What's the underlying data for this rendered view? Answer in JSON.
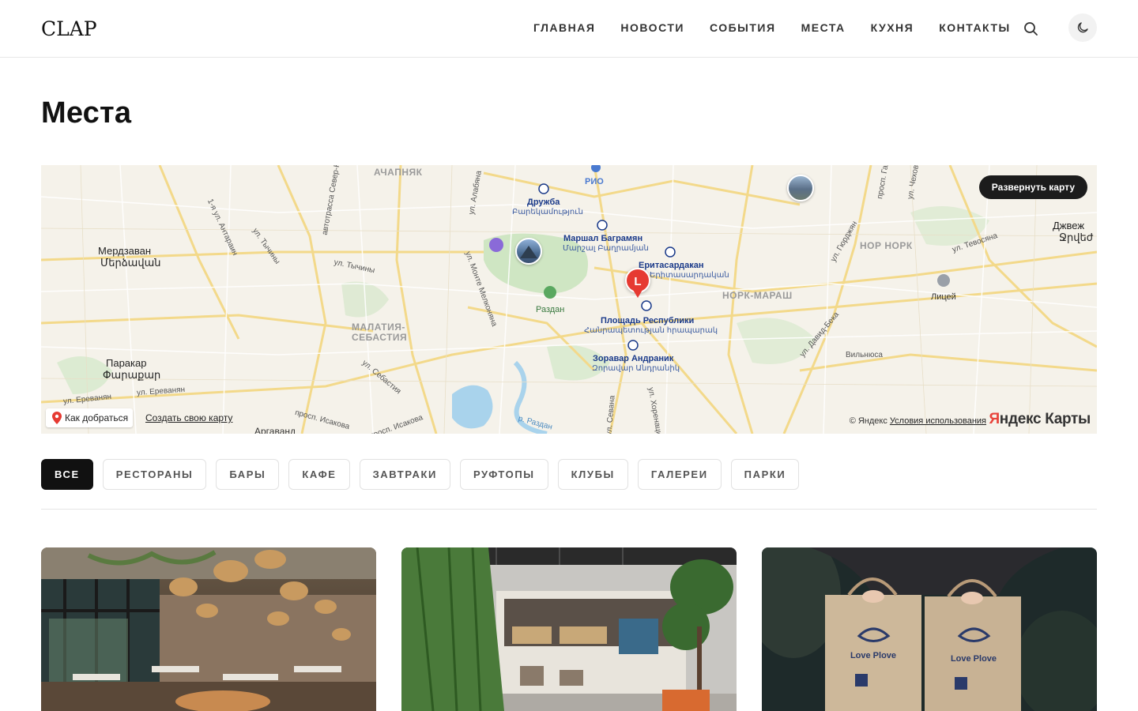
{
  "header": {
    "logo": "CLAP",
    "nav": [
      "ГЛАВНАЯ",
      "НОВОСТИ",
      "СОБЫТИЯ",
      "МЕСТА",
      "КУХНЯ",
      "КОНТАКТЫ"
    ],
    "search_icon": "search-icon",
    "theme_icon": "moon-icon"
  },
  "page": {
    "title": "Места"
  },
  "map": {
    "expand_label": "Развернуть карту",
    "route_label": "Как добраться",
    "create_label": "Создать свою карту",
    "copyright": "© Яндекс",
    "terms": "Условия использования",
    "brand_red": "Я",
    "brand_rest": "ндекс Карты",
    "marker_letter": "L",
    "labels": {
      "achapnyak": "АЧАПНЯК",
      "rio": "РИО",
      "druzhba": "Дружба",
      "druzhba_am": "Բարեկամություն",
      "marshal": "Маршал Баграмян",
      "marshal_am": "Մարշալ Բաղրամյան",
      "eritasardakan": "Еритасардакан",
      "eritasardakan_am": "Երիտասարդական",
      "razdan": "Раздан",
      "ploshchad": "Площадь Республики",
      "ploshchad_am": "Հանրապետության հրապարակ",
      "zoravar": "Зоравар Андраник",
      "zoravar_am": "Զորավար Անդրանիկ",
      "nork_marash": "НОРК-МАРАШ",
      "nor_nork": "НОР НОРК",
      "malatia": "МАЛАТИЯ-",
      "sebastia": "СЕБАСТИЯ",
      "merdzavan": "Мердзаван",
      "merdzavan_am": "Մերձավան",
      "parakar": "Паракар",
      "parakar_am": "Փարաքար",
      "dzhvezh": "Джвеж",
      "dzhvezh_am": "Ջրվեժ",
      "litsey": "Лицей",
      "vilnyusa": "Вильнюса",
      "ul_erevanyan1": "ул. Ереванян",
      "ul_erevanyan2": "ул. Ереванян",
      "ul_tychiny": "ул. Тычины",
      "ul_tychiny2": "ул. Тычины",
      "ul_monte": "ул. Монте Мелконяна",
      "ul_sebastia": "ул. Себастия",
      "ul_tevosyana": "ул. Тевосяна",
      "ul_david_beka": "ул. Давид-Бека",
      "ul_gyurdzhan": "ул. Гюрджян",
      "ul_alabyana": "ул. Алабяна",
      "ul_sevana": "ул. Севана",
      "ul_khorenatsi": "ул. Хоренаци",
      "ul_antarayin": "1-я ул. Антараин",
      "ul_avtotrassa": "автотрасса Север-Юг",
      "prosp_isakova": "просп. Исакова",
      "prosp_isakova2": "просп. Исакова",
      "r_razdan": "р. Раздан",
      "argavand": "Аргаванд",
      "prosp_gaya": "просп. Гая",
      "tchekhova": "ул. Чехова"
    }
  },
  "filters": [
    {
      "label": "ВСЕ",
      "active": true
    },
    {
      "label": "РЕСТОРАНЫ",
      "active": false
    },
    {
      "label": "БАРЫ",
      "active": false
    },
    {
      "label": "КАФЕ",
      "active": false
    },
    {
      "label": "ЗАВТРАКИ",
      "active": false
    },
    {
      "label": "РУФТОПЫ",
      "active": false
    },
    {
      "label": "КЛУБЫ",
      "active": false
    },
    {
      "label": "ГАЛЕРЕИ",
      "active": false
    },
    {
      "label": "ПАРКИ",
      "active": false
    }
  ],
  "cards": [
    {
      "name": "restaurant-interior"
    },
    {
      "name": "cafe-storefront"
    },
    {
      "name": "love-plove-bags",
      "brand": "Love Plove"
    }
  ],
  "colors": {
    "accent_dark": "#111111",
    "marker_red": "#e63a32",
    "metro_blue": "#1a3a8a"
  }
}
